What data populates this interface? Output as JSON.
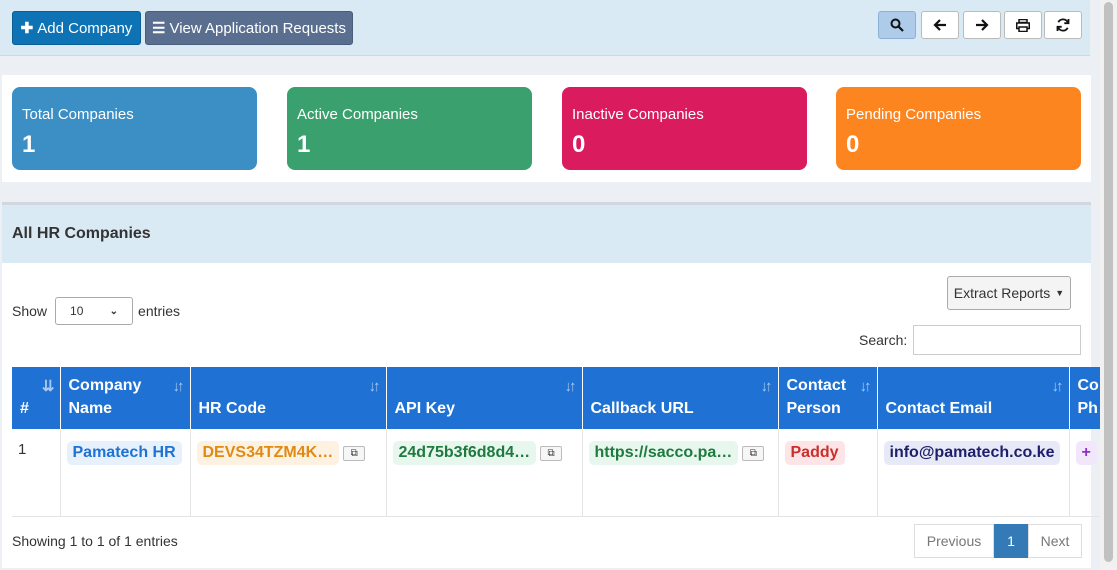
{
  "toolbar": {
    "add_label": "Add Company",
    "view_label": "View Application Requests"
  },
  "stats": [
    {
      "label": "Total Companies",
      "value": "1",
      "color": "#3b8fc4"
    },
    {
      "label": "Active Companies",
      "value": "1",
      "color": "#3aa06e"
    },
    {
      "label": "Inactive Companies",
      "value": "0",
      "color": "#da1b5e"
    },
    {
      "label": "Pending Companies",
      "value": "0",
      "color": "#fd851f"
    }
  ],
  "panel": {
    "title": "All HR Companies",
    "show_label": "Show",
    "show_value": "10",
    "entries_label": "entries",
    "extract_label": "Extract Reports",
    "search_label": "Search:"
  },
  "table": {
    "headers": [
      "#",
      "Company Name",
      "HR Code",
      "API Key",
      "Callback URL",
      "Contact Person",
      "Contact Email",
      "Co Ph"
    ],
    "rows": [
      {
        "index": "1",
        "company": "Pamatech HR",
        "hr_code": "DEVS34TZM4K…",
        "api_key": "24d75b3f6d8d4…",
        "callback": "https://sacco.pa…",
        "contact_person": "Paddy",
        "contact_email": "info@pamatech.co.ke",
        "phone": "+"
      }
    ]
  },
  "footer": {
    "info": "Showing 1 to 1 of 1 entries",
    "prev": "Previous",
    "page": "1",
    "next": "Next"
  }
}
